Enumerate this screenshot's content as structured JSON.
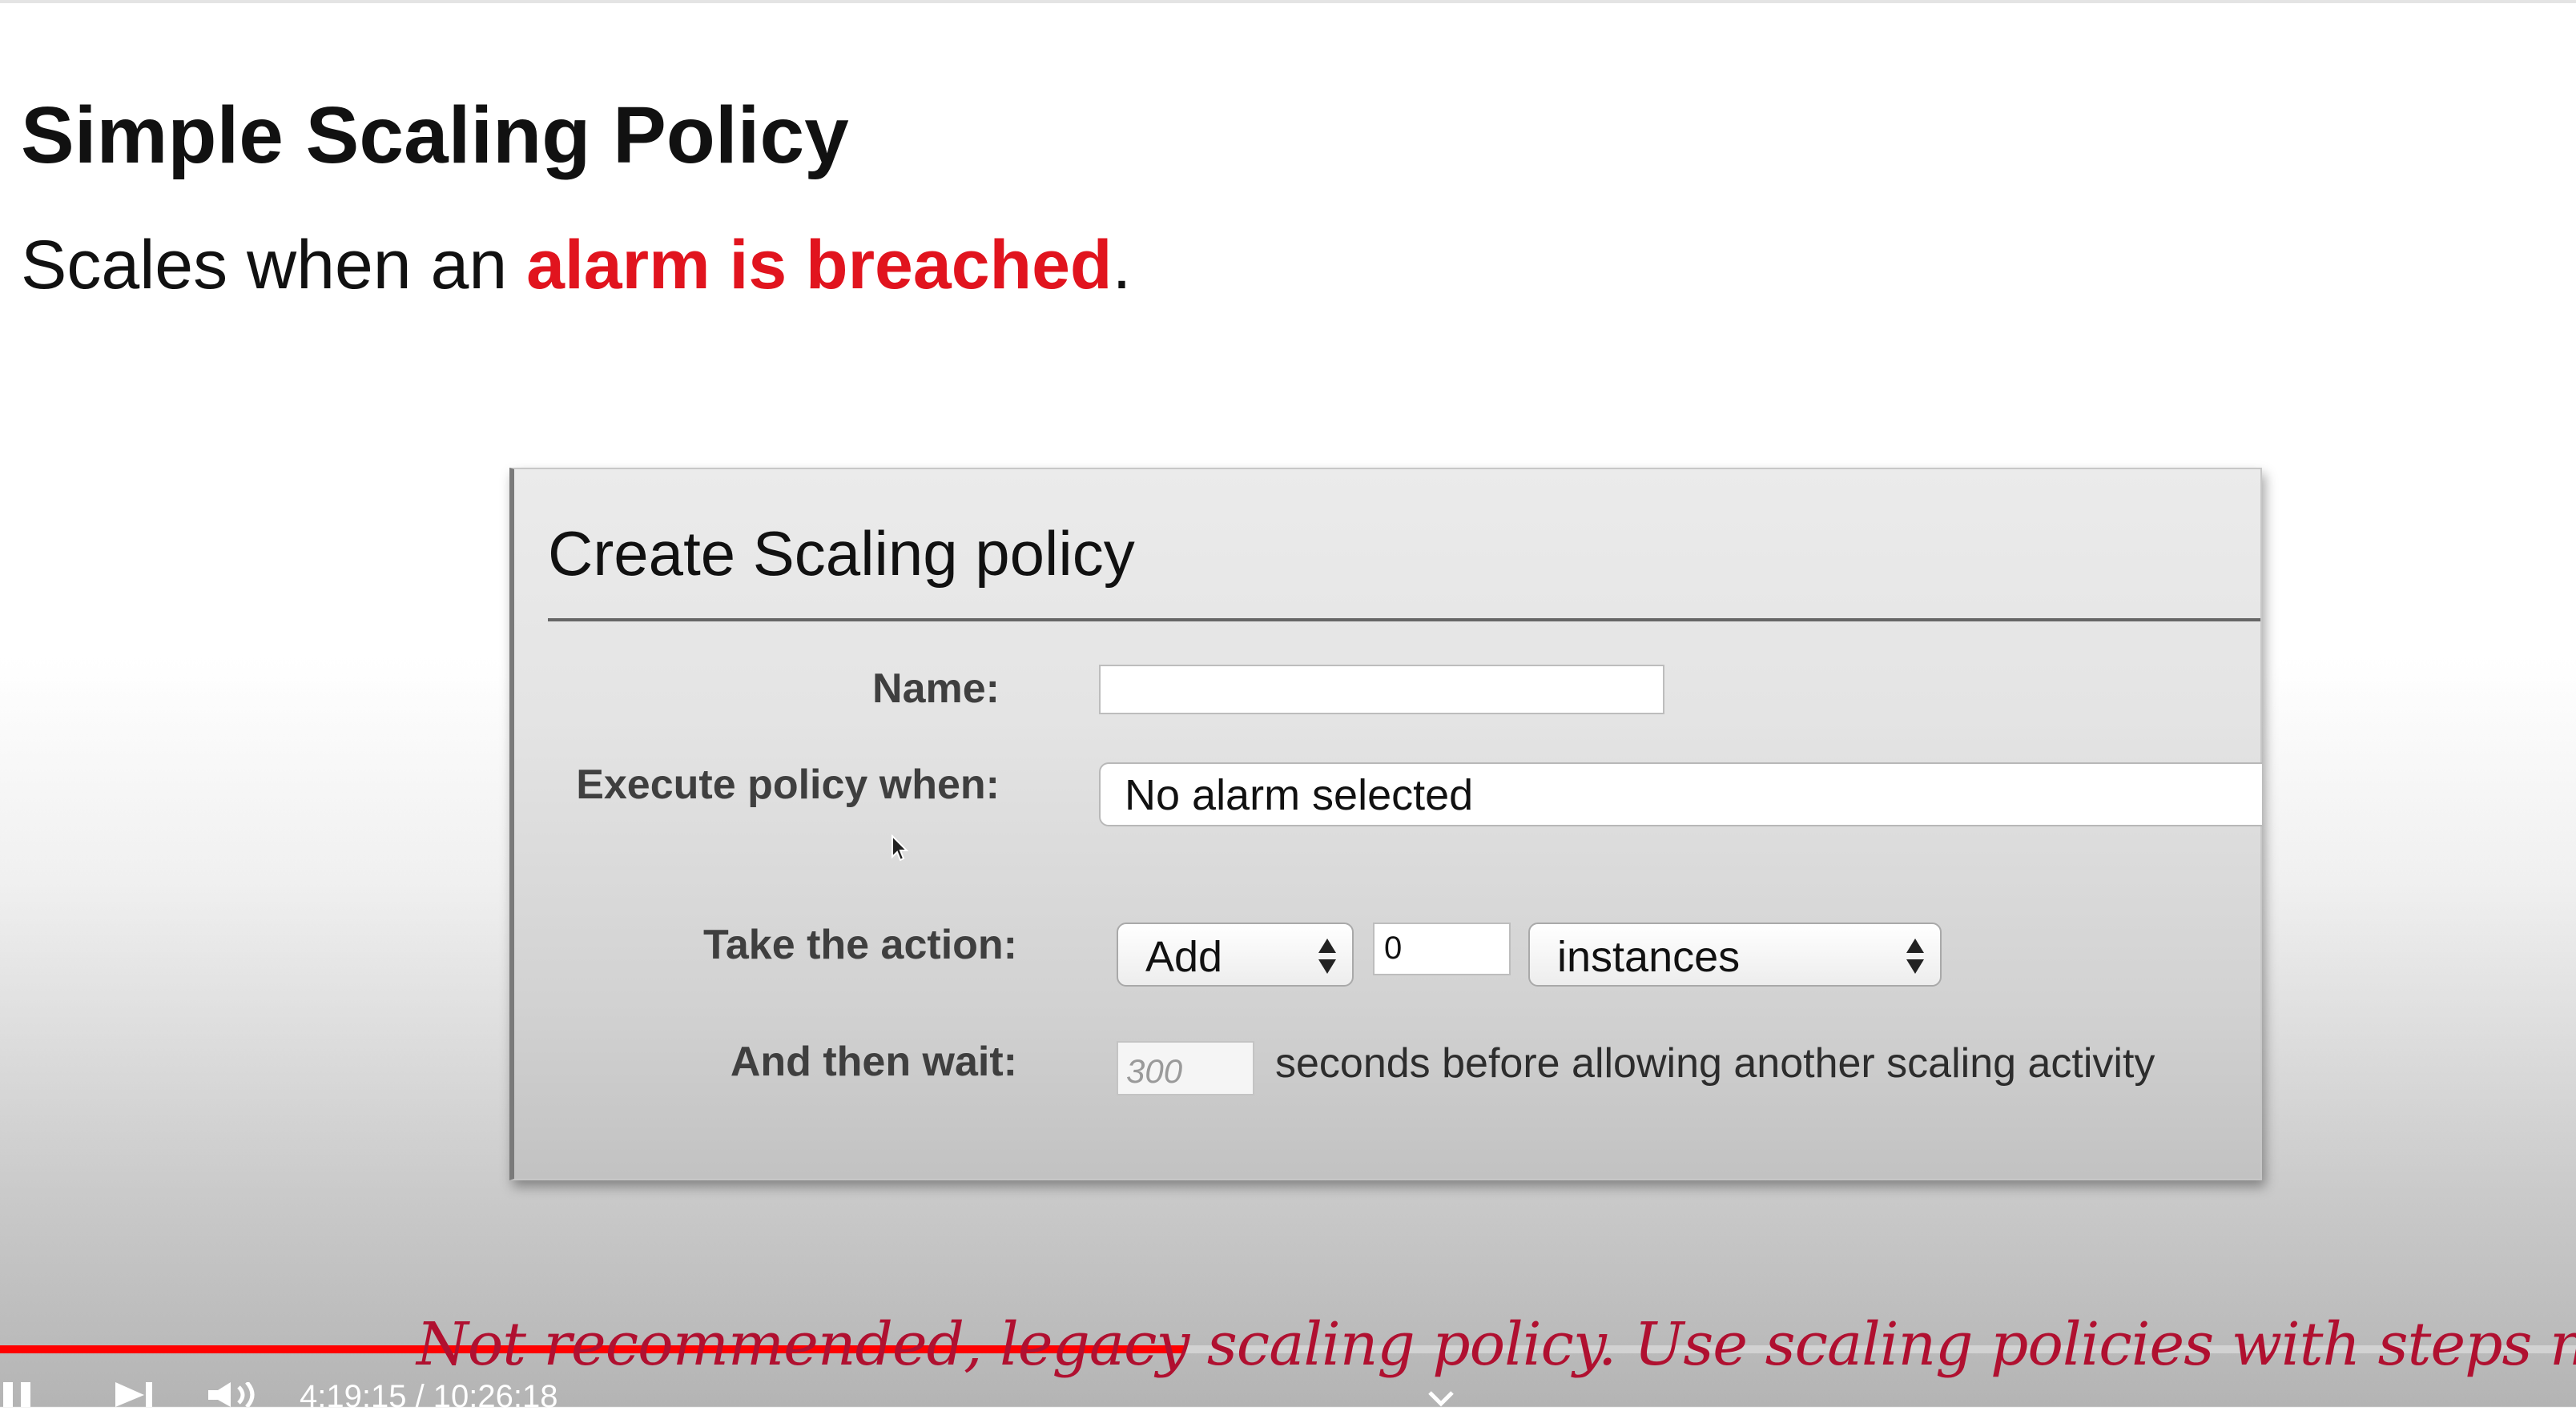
{
  "slide": {
    "title": "Simple Scaling Policy",
    "subtitle_prefix": "Scales when an ",
    "subtitle_highlight": "alarm is breached",
    "subtitle_suffix": ".",
    "highlight_color": "#e1141e"
  },
  "dialog": {
    "title": "Create Scaling policy",
    "name_label": "Name:",
    "name_value": "",
    "execute_label": "Execute policy when:",
    "execute_value": "No alarm selected",
    "action_label": "Take the action:",
    "action_value": "Add",
    "action_count": "0",
    "action_unit": "instances",
    "wait_label": "And then wait:",
    "wait_placeholder": "300",
    "wait_suffix": "seconds before allowing another scaling activity"
  },
  "annotation": {
    "text": "Not recommended, legacy scaling policy. Use scaling policies with steps now.",
    "color": "#b01030"
  },
  "player": {
    "time_display": "4:19:15 / 10:26:18",
    "progress": 0.46,
    "icons": [
      "pause-icon",
      "next-icon",
      "volume-icon",
      "chevron-down-icon"
    ],
    "progress_color": "#ff0000"
  }
}
